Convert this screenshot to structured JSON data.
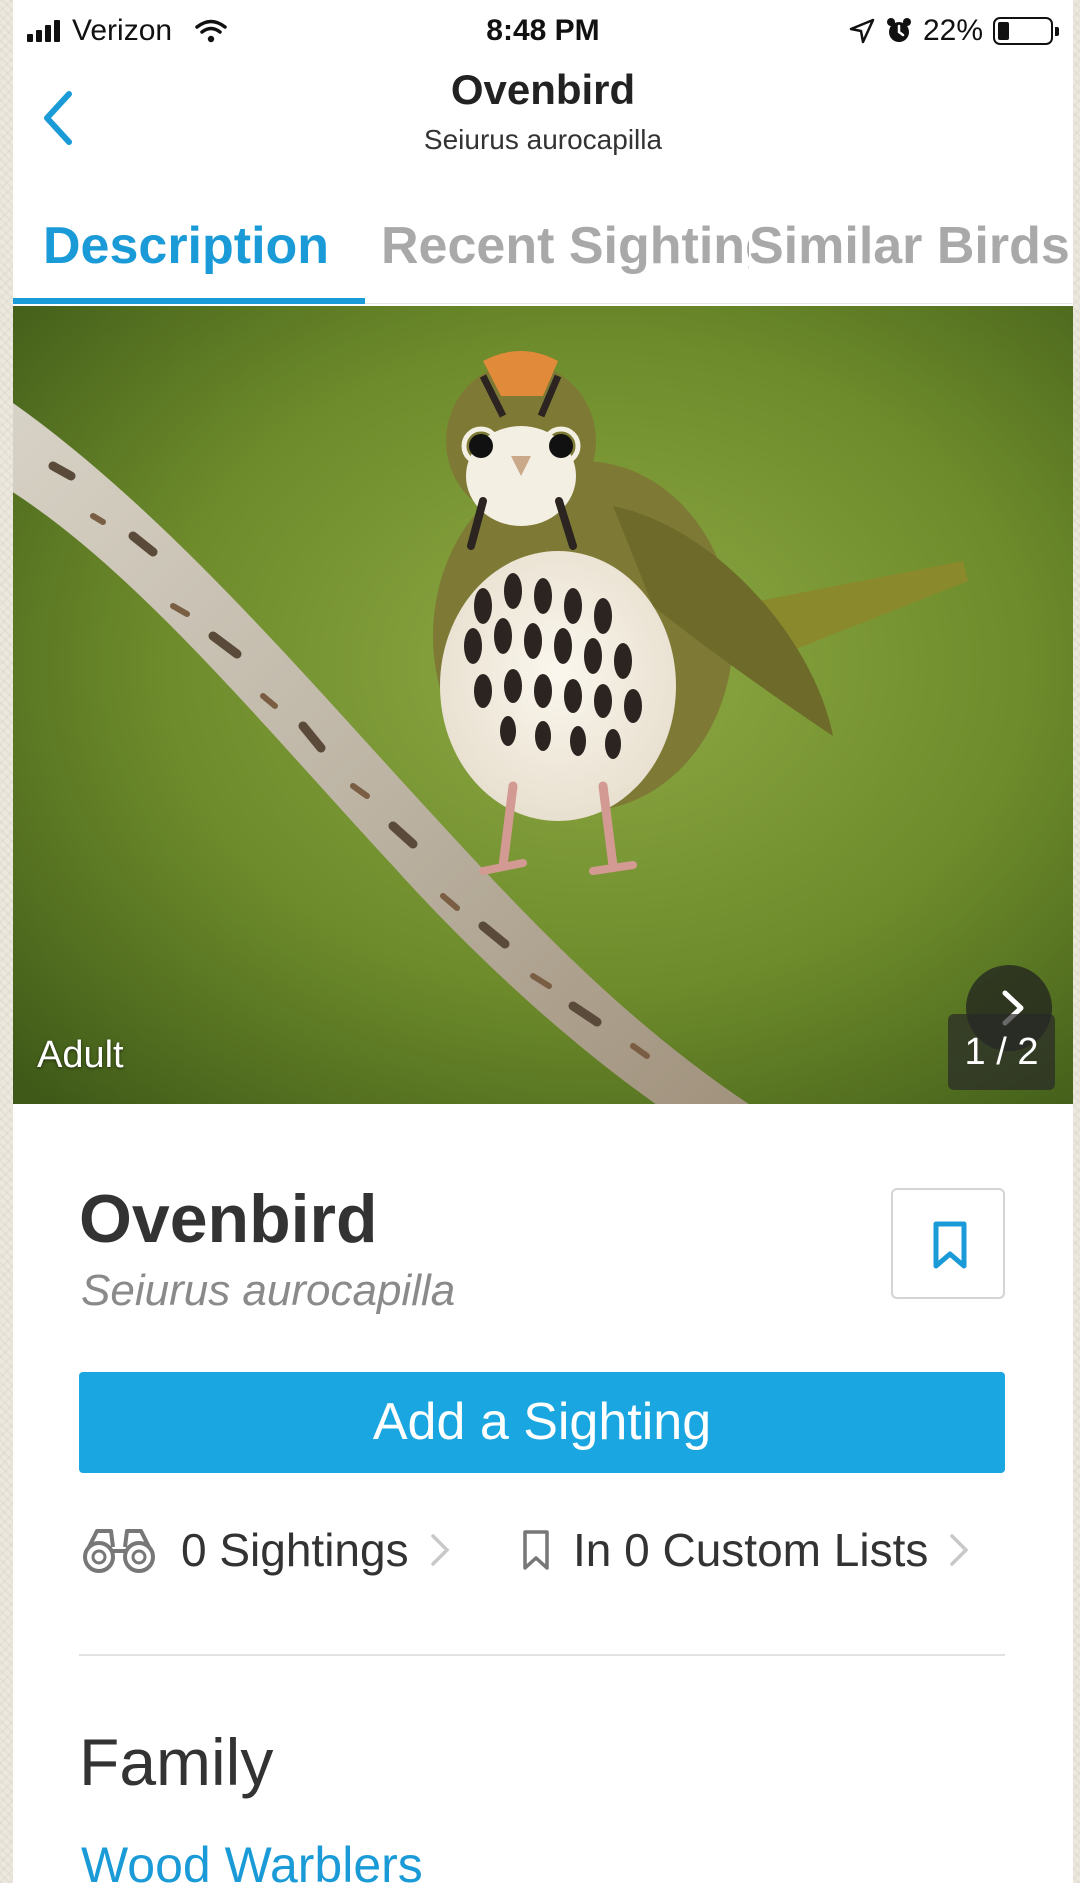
{
  "status_bar": {
    "carrier": "Verizon",
    "time": "8:48 PM",
    "battery_percent": "22%",
    "battery_level": 0.22,
    "icons": [
      "signal-icon",
      "wifi-icon",
      "location-arrow-icon",
      "alarm-clock-icon",
      "battery-icon"
    ]
  },
  "header": {
    "title": "Ovenbird",
    "subtitle": "Seiurus aurocapilla",
    "back_icon": "chevron-left-icon"
  },
  "tabs": [
    {
      "label": "Description",
      "active": true
    },
    {
      "label": "Recent Sightings",
      "active": false
    },
    {
      "label": "Similar Birds",
      "active": false
    }
  ],
  "photo": {
    "caption": "Adult",
    "counter": "1 / 2",
    "next_icon": "chevron-right-icon"
  },
  "species": {
    "name": "Ovenbird",
    "scientific_name": "Seiurus aurocapilla",
    "bookmark_icon": "bookmark-icon"
  },
  "actions": {
    "add_sighting_label": "Add a Sighting"
  },
  "stats": {
    "sightings_label": "0 Sightings",
    "sightings_icon": "binoculars-icon",
    "lists_label": "In 0 Custom Lists",
    "lists_icon": "bookmark-outline-icon"
  },
  "family": {
    "heading": "Family",
    "name": "Wood Warblers"
  },
  "colors": {
    "accent": "#1a9bd7",
    "button": "#1aa7e1",
    "inactive_tab": "#a9a9a9",
    "text": "#333333"
  }
}
